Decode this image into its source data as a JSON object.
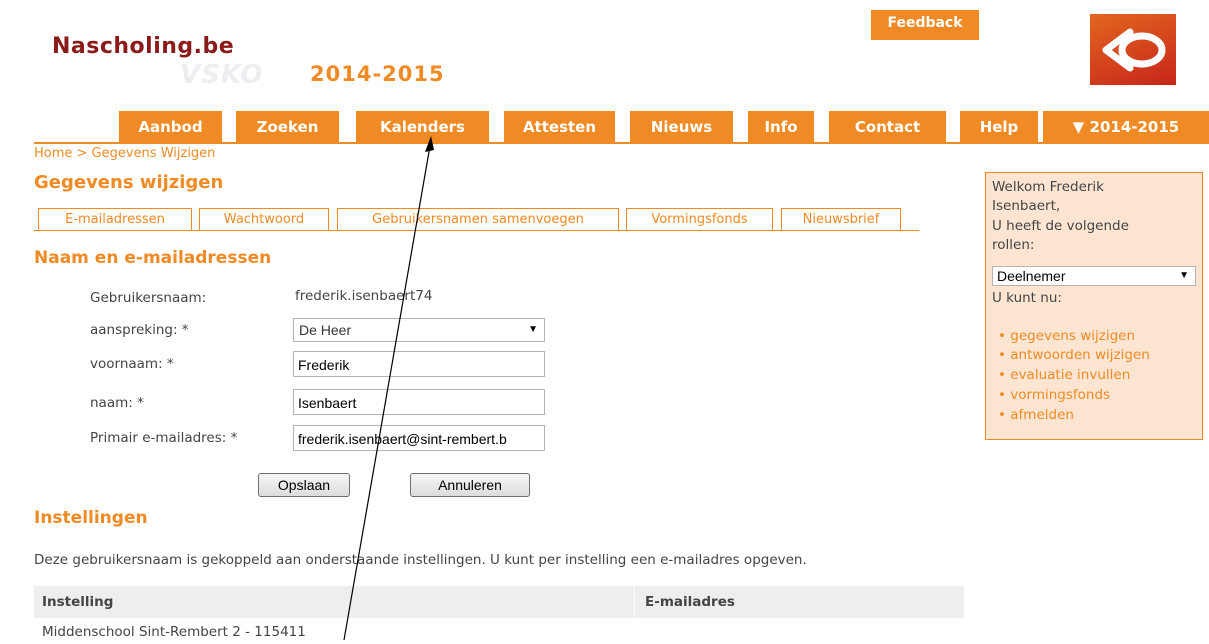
{
  "header": {
    "site_name": "Nascholing.be",
    "vsko": "VSKO",
    "year": "2014-2015",
    "feedback": "Feedback"
  },
  "nav": [
    "Aanbod",
    "Zoeken",
    "Kalenders",
    "Attesten",
    "Nieuws",
    "Info",
    "Contact",
    "Help",
    "▼ 2014-2015"
  ],
  "breadcrumb": "Home > Gegevens Wijzigen",
  "page_title": "Gegevens wijzigen",
  "tabs": [
    "E-mailadressen",
    "Wachtwoord",
    "Gebruikersnamen samenvoegen",
    "Vormingsfonds",
    "Nieuwsbrief"
  ],
  "section_title": "Naam en e-mailadressen",
  "form": {
    "username_label": "Gebruikersnaam:",
    "username_value": "frederik.isenbaert74",
    "salutation_label": "aanspreking: *",
    "salutation_value": "De Heer",
    "firstname_label": "voornaam: *",
    "firstname_value": "Frederik",
    "lastname_label": "naam: *",
    "lastname_value": "Isenbaert",
    "email_label": "Primair e-mailadres: *",
    "email_value": "frederik.isenbaert@sint-rembert.b",
    "save": "Opslaan",
    "cancel": "Annuleren"
  },
  "institutions": {
    "title": "Instellingen",
    "description": "Deze gebruikersnaam is gekoppeld aan onderstaande instellingen. U kunt per instelling een e-mailadres opgeven.",
    "col_institution": "Instelling",
    "col_email": "E-mailadres",
    "rows": [
      "Middenschool Sint-Rembert 2 - 115411"
    ]
  },
  "sidebar": {
    "welcome1": "Welkom Frederik",
    "welcome2": "Isenbaert,",
    "roles1": "U heeft de volgende",
    "roles2": "rollen:",
    "role_value": "Deelnemer",
    "can_now": "U kunt nu:",
    "links": [
      "gegevens wijzigen",
      "antwoorden wijzigen",
      "evaluatie invullen",
      "vormingsfonds",
      "afmelden"
    ]
  },
  "colors": {
    "accent": "#f08a24",
    "brand": "#8b1a1a",
    "panel_bg": "#fde5d2"
  }
}
